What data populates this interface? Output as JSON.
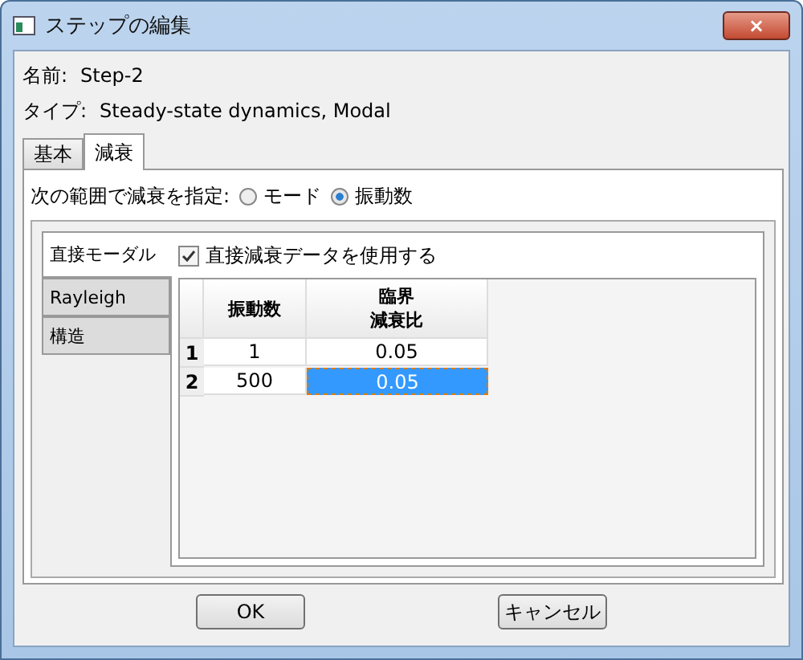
{
  "window": {
    "title": "ステップの編集",
    "close": "×"
  },
  "fields": [
    {
      "label": "名前:",
      "value": "Step-2"
    },
    {
      "label": "タイプ:",
      "value": "Steady-state dynamics, Modal"
    }
  ],
  "tabs": [
    {
      "label": "基本",
      "selected": false
    },
    {
      "label": "減衰",
      "selected": true
    }
  ],
  "damping_range": {
    "label": "次の範囲で減衰を指定:",
    "options": [
      {
        "label": "モード",
        "selected": false
      },
      {
        "label": "振動数",
        "selected": true
      }
    ]
  },
  "side_tabs": [
    {
      "label": "直接モーダル",
      "selected": true
    },
    {
      "label": "Rayleigh",
      "selected": false
    },
    {
      "label": "構造",
      "selected": false
    }
  ],
  "use_direct": {
    "label": "直接減衰データを使用する",
    "checked": true
  },
  "table": {
    "columns": [
      {
        "lines": [
          "振動数"
        ]
      },
      {
        "lines": [
          "臨界",
          "減衰比"
        ]
      }
    ],
    "rows": [
      {
        "index": "1",
        "cells": [
          {
            "text": "1",
            "selected": false
          },
          {
            "text": "0.05",
            "selected": false
          }
        ]
      },
      {
        "index": "2",
        "cells": [
          {
            "text": "500",
            "selected": false
          },
          {
            "text": "0.05",
            "selected": true
          }
        ]
      }
    ]
  },
  "buttons": [
    "OK",
    "キャンセル"
  ]
}
